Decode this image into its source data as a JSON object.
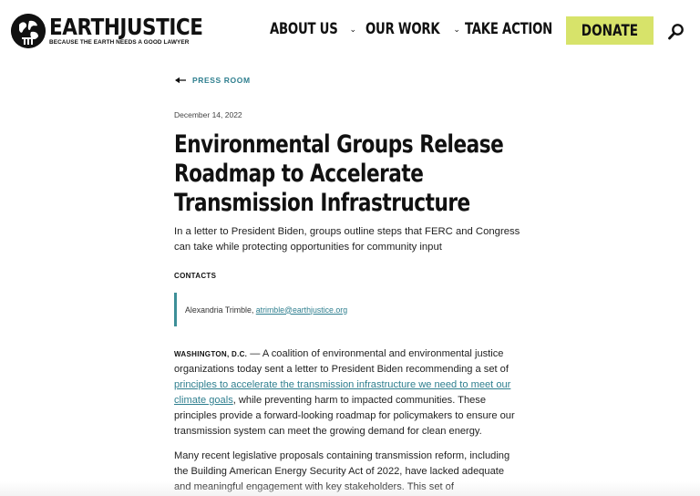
{
  "header": {
    "logo_name": "EARTHJUSTICE",
    "logo_tagline": "BECAUSE THE EARTH NEEDS A GOOD LAWYER",
    "nav": [
      {
        "label": "ABOUT US",
        "chevron": "⌄"
      },
      {
        "label": "OUR WORK",
        "chevron": "⌄"
      },
      {
        "label": "TAKE ACTION",
        "chevron": "⌄"
      }
    ],
    "donate_label": "DONATE",
    "search_icon": "search-icon"
  },
  "colors": {
    "accent_teal": "#2f7f8f",
    "donate_bg": "#d7e36a",
    "contact_bar": "#3d8f98"
  },
  "article": {
    "back_label": "PRESS ROOM",
    "date": "December 14, 2022",
    "title": "Environmental Groups Release Roadmap to Accelerate Transmission Infrastructure",
    "dek": "In a letter to President Biden, groups outline steps that FERC and Congress can take while protecting opportunities for community input",
    "contacts_heading": "CONTACTS",
    "contact_name": "Alexandria Trimble, ",
    "contact_email": "atrimble@earthjustice.org",
    "p1_dateline": "WASHINGTON, D.C.",
    "p1_before_link": " — A coalition of environmental and environmental justice organizations today sent a letter to President Biden recommending a set of ",
    "p1_link": "principles to accelerate the transmission infrastructure we need to meet our climate goals",
    "p1_after_link": ", while preventing harm to impacted communities. These principles provide a forward-looking roadmap for policymakers to ensure our transmission system can meet the growing demand for clean energy.",
    "p2": "Many recent legislative proposals containing transmission reform, including the Building American Energy Security Act of 2022, have lacked adequate and meaningful engagement with key stakeholders. This set of"
  }
}
